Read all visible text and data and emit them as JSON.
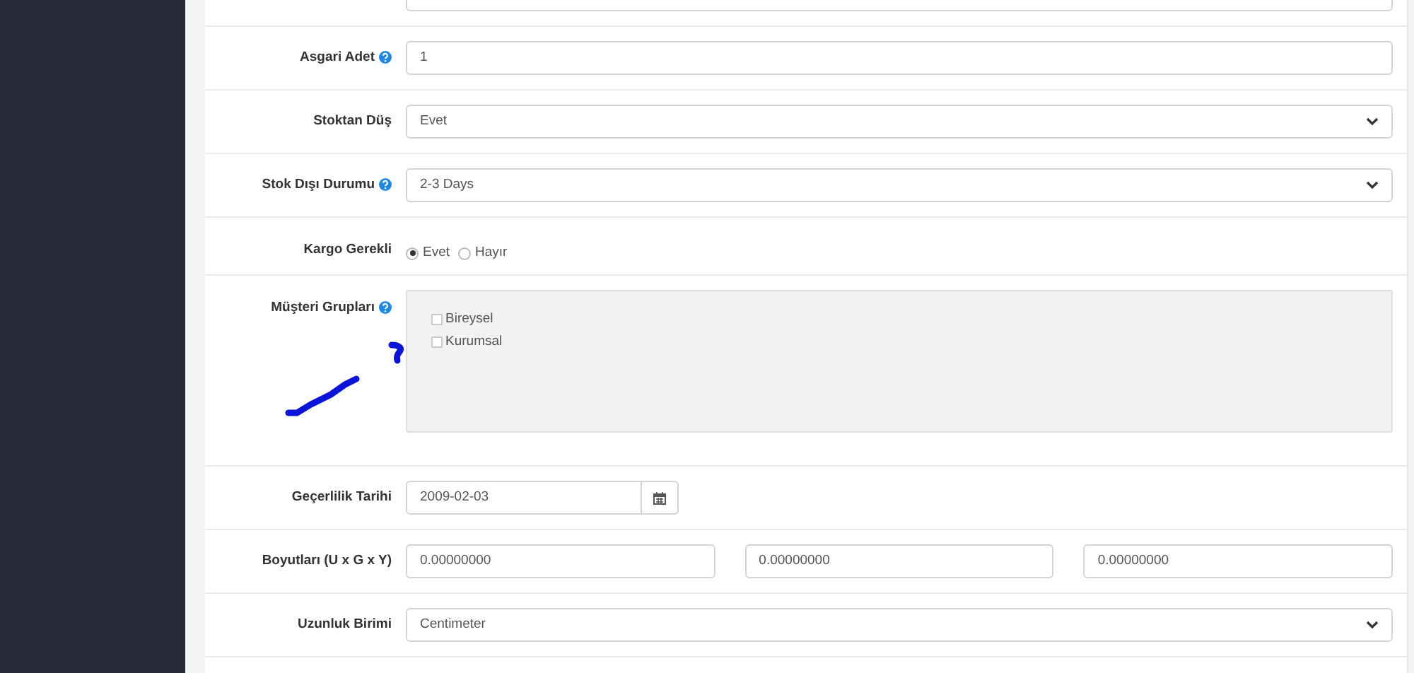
{
  "rows": [
    {
      "kind": "text"
    },
    {
      "kind": "text",
      "label": "Asgari Adet",
      "help": true,
      "value": "1"
    },
    {
      "kind": "select",
      "label": "Stoktan Düş",
      "help": false,
      "value": "Evet"
    },
    {
      "kind": "select",
      "label": "Stok Dışı Durumu",
      "help": true,
      "value": "2-3 Days"
    },
    {
      "kind": "radio",
      "label": "Kargo Gerekli",
      "help": false,
      "options": [
        {
          "label": "Evet",
          "selected": true
        },
        {
          "label": "Hayır",
          "selected": false
        }
      ]
    },
    {
      "kind": "checklist",
      "label": "Müşteri Grupları",
      "help": true,
      "options": [
        {
          "label": "Bireysel",
          "checked": false
        },
        {
          "label": "Kurumsal",
          "checked": false
        }
      ]
    },
    {
      "kind": "date",
      "label": "Geçerlilik Tarihi",
      "help": false,
      "value": "2009-02-03"
    },
    {
      "kind": "dimensions",
      "label": "Boyutları (U x G x Y)",
      "help": false,
      "values": [
        "0.00000000",
        "0.00000000",
        "0.00000000"
      ]
    },
    {
      "kind": "select",
      "label": "Uzunluk Birimi",
      "help": false,
      "value": "Centimeter"
    },
    {
      "kind": "empty"
    }
  ]
}
